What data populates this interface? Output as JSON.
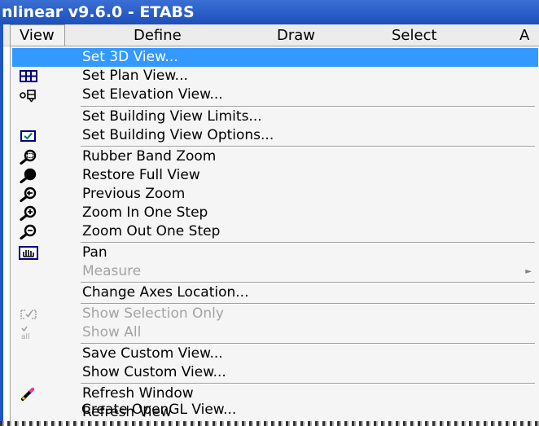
{
  "window": {
    "title": "nlinear v9.6.0 - ETABS"
  },
  "menubar": {
    "items": [
      {
        "label": "View",
        "active": true
      },
      {
        "label": "Define"
      },
      {
        "label": "Draw"
      },
      {
        "label": "Select"
      },
      {
        "label": "A"
      }
    ]
  },
  "view_menu": {
    "items": [
      {
        "label": "Set 3D View...",
        "icon": "none",
        "state": "highlighted"
      },
      {
        "label": "Set Plan View...",
        "icon": "plan-grid-icon"
      },
      {
        "label": "Set Elevation View...",
        "icon": "elevation-icon"
      },
      {
        "label": "Set Building View Limits...",
        "icon": "none"
      },
      {
        "label": "Set Building View Options...",
        "icon": "view-options-icon"
      },
      {
        "label": "Rubber Band Zoom",
        "icon": "rubber-band-zoom-icon"
      },
      {
        "label": "Restore Full View",
        "icon": "restore-view-icon"
      },
      {
        "label": "Previous Zoom",
        "icon": "previous-zoom-icon"
      },
      {
        "label": "Zoom In One Step",
        "icon": "zoom-in-icon"
      },
      {
        "label": "Zoom Out One Step",
        "icon": "zoom-out-icon"
      },
      {
        "label": "Pan",
        "icon": "pan-hand-icon"
      },
      {
        "label": "Measure",
        "icon": "none",
        "state": "disabled",
        "submenu": true
      },
      {
        "label": "Change Axes Location...",
        "icon": "none"
      },
      {
        "label": "Show Selection Only",
        "icon": "show-selection-icon",
        "state": "disabled"
      },
      {
        "label": "Show All",
        "icon": "show-all-icon",
        "state": "disabled"
      },
      {
        "label": "Save Custom View...",
        "icon": "none"
      },
      {
        "label": "Show Custom View...",
        "icon": "none"
      },
      {
        "label": "Refresh Window",
        "icon": "pencil-icon"
      },
      {
        "label": "Refresh View",
        "icon": "none"
      },
      {
        "label": "Create OpenGL View...",
        "icon": "none"
      }
    ],
    "submenu_arrow": "►"
  },
  "colors": {
    "titlebar": "#1d4fb8",
    "highlight": "#3399ff",
    "disabled_text": "#a3a3a3",
    "icon_teal": "#008080",
    "icon_navy": "#000080"
  }
}
